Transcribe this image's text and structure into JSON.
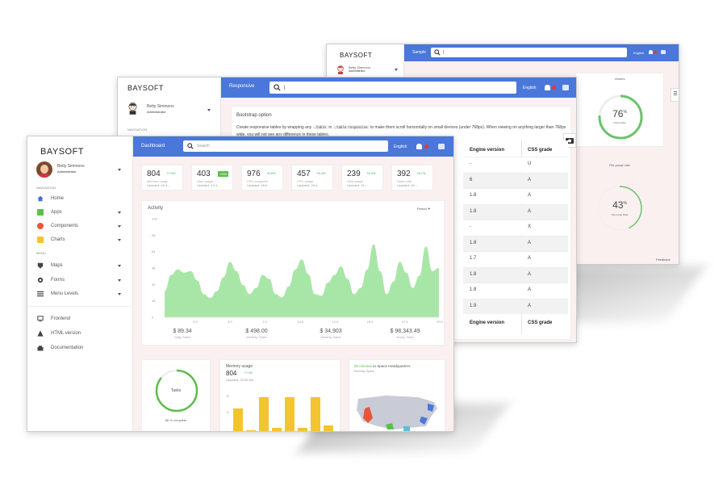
{
  "brand": "BAYSOFT",
  "user": {
    "name": "Betty Simmons",
    "role": "Administrator"
  },
  "language": "English",
  "colors": {
    "accent": "#4a77d9",
    "green": "#6cc36c",
    "area": "#a8e6a8",
    "yellow": "#f4c430",
    "danger": "#e53935"
  },
  "back": {
    "title": "Sample",
    "search": "|",
    "visitors_title": "Visitors",
    "visitors_value": "76",
    "visitors_unit": "%",
    "visitors_label": "Visitor Rate",
    "purge_title": "File purge rate",
    "purge_value": "43",
    "purge_unit": "%",
    "purge_label": "File purge Rate",
    "visitors_gauge": 76,
    "purge_gauge": 43,
    "feedback": "Feedback"
  },
  "middle": {
    "title": "Responsive",
    "search": "|",
    "nav_label": "NAVIGATION",
    "card_title": "Bootstrap option",
    "card_text_1": "Create responsive tables by wrapping any",
    "code_1": ".table",
    "card_text_2": "in",
    "code_2": ".table-responsive",
    "card_text_3": "to make them scroll horizontally on small devices (under 768px). When viewing on",
    "card_text_4": "anything larger than 768px wide, you will not see any difference in these tables.",
    "table": {
      "headers": [
        "Engine version",
        "CSS grade"
      ],
      "rows": [
        [
          "-",
          "U"
        ],
        [
          "6",
          "A"
        ],
        [
          "1.8",
          "A"
        ],
        [
          "1.8",
          "A"
        ],
        [
          "-",
          "X"
        ],
        [
          "1.8",
          "A"
        ],
        [
          "1.7",
          "A"
        ],
        [
          "1.8",
          "A"
        ],
        [
          "1.8",
          "A"
        ],
        [
          "1.9",
          "A"
        ]
      ],
      "footers": [
        "Engine version",
        "CSS grade"
      ]
    }
  },
  "front": {
    "title": "Dashboard",
    "search": "Search",
    "nav_label": "NAVIGATION",
    "nav": [
      "Home",
      "Apps",
      "Components",
      "Charts"
    ],
    "menu_label": "MENU",
    "menu": [
      "Maps",
      "Forms",
      "Menu Levels"
    ],
    "links": [
      "Frontend",
      "HTML version",
      "Documentation"
    ],
    "stats": [
      {
        "value": "804",
        "delta": "+7.0%",
        "label": "Memory usage",
        "updated": "Updated: 05:3..."
      },
      {
        "value": "403",
        "delta": "+20K",
        "label": "Disk usage",
        "updated": "Updated: 12:4..."
      },
      {
        "value": "976",
        "delta": "+6.5%",
        "label": "CPU complete",
        "updated": "Updated: 08:2..."
      },
      {
        "value": "457",
        "delta": "+6.4%",
        "label": "CPU usage",
        "updated": "Updated: 09:4..."
      },
      {
        "value": "239",
        "delta": "+4.0%",
        "label": "Disk usage",
        "updated": "Updated: 11:..."
      },
      {
        "value": "392",
        "delta": "+6.7%",
        "label": "Sales rate",
        "updated": "Updated: 02:..."
      }
    ],
    "activity_title": "Activity",
    "period_label": "Period",
    "sales": [
      {
        "value": "$ 89.34",
        "label": "Daily Sales"
      },
      {
        "value": "$ 498.00",
        "label": "Monthly Sales"
      },
      {
        "value": "$ 34,903",
        "label": "Monthly Sales"
      },
      {
        "value": "$ 98,343.49",
        "label": "Yearly Sales"
      }
    ],
    "tasks_label": "Tasks",
    "tasks_progress": 0.86,
    "tasks_complete": "86 % complete",
    "memory_title": "Memory usage",
    "memory_value": "804",
    "memory_delta": "+7.0%",
    "memory_updated": "Updated: 05:35 AM",
    "memory_ticks": [
      "40",
      "20"
    ],
    "memory_bars": [
      28,
      5,
      40,
      8,
      40,
      8,
      40,
      10
    ],
    "space_highlight": "50 minutes",
    "space_rest": "to Space Headquarters",
    "space_sub": "Kennedy Space"
  },
  "chart_data": {
    "type": "area",
    "title": "Activity",
    "x": [
      0,
      0.5,
      1,
      1.5,
      2,
      2.5,
      3,
      3.5,
      4,
      4.5,
      5,
      5.5,
      6,
      6.5,
      7,
      7.5,
      8,
      8.5,
      9,
      9.5,
      10,
      10.5,
      11,
      11.5,
      12,
      12.5,
      13,
      13.5,
      14,
      14.5,
      15,
      15.5,
      16,
      16.5,
      17,
      17.5,
      18,
      18.5,
      19,
      19.5,
      20,
      20.5,
      21
    ],
    "values": [
      34,
      55,
      62,
      58,
      60,
      48,
      30,
      25,
      34,
      52,
      72,
      60,
      42,
      30,
      38,
      55,
      50,
      30,
      26,
      40,
      62,
      75,
      56,
      30,
      28,
      45,
      55,
      66,
      50,
      30,
      38,
      62,
      95,
      60,
      30,
      46,
      72,
      58,
      38,
      54,
      92,
      60,
      64
    ],
    "xticks": [
      "2.0",
      "4.0",
      "7.0",
      "10.0",
      "12.0",
      "15.0",
      "17.5",
      "20.0"
    ],
    "yticks": [
      "128",
      "96",
      "64",
      "48",
      "32",
      "16",
      "0"
    ],
    "ylim": [
      0,
      128
    ],
    "xlim": [
      0,
      21
    ]
  }
}
